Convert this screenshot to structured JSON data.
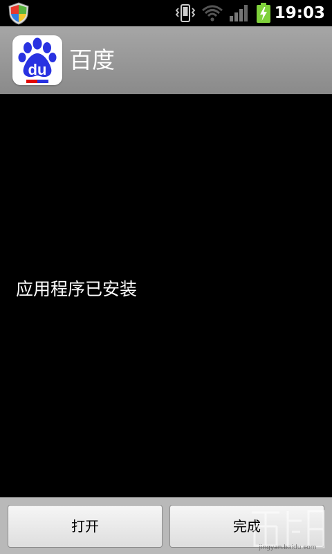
{
  "status_bar": {
    "time": "19:03",
    "icons": [
      "shield-icon",
      "vibrate-icon",
      "wifi-icon",
      "signal-icon",
      "battery-charging-icon"
    ]
  },
  "header": {
    "app_name": "百度",
    "app_icon_text": "du",
    "app_icon": "baidu-paw-icon"
  },
  "main": {
    "message": "应用程序已安装"
  },
  "buttons": {
    "open_label": "打开",
    "done_label": "完成"
  },
  "watermark": {
    "text": "jingyan.baidu.com",
    "icon": "baidu-jingyan-watermark"
  },
  "colors": {
    "header_bg": "#999999",
    "baidu_blue": "#2932e1",
    "battery_green": "#7fd13b"
  }
}
